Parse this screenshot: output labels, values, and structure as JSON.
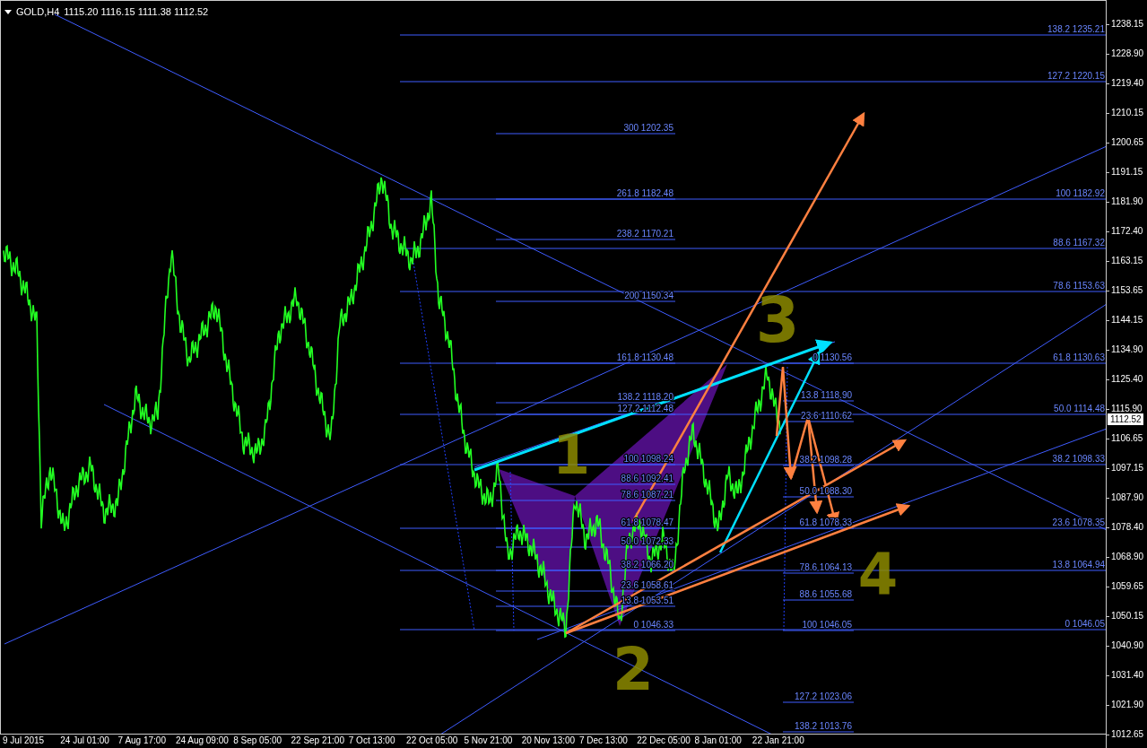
{
  "header": {
    "symbol": "GOLD,H4",
    "quotes": "1115.20 1116.15 1111.38 1112.52"
  },
  "fib_sets": [
    {
      "labels": [
        "300 1202.35",
        "261.8 1182.48",
        "238.2 1170.21",
        "200 1150.34",
        "161.8 1130.48",
        "138.2 1118.20",
        "127.2 1112.48",
        "100 1098.24",
        "88.6 1092.41",
        "78.6 1087.21",
        "61.8 1078.47",
        "50.0 1072.33",
        "38.2 1066.20",
        "23.6 1058.61",
        "13.8 1053.51",
        "0 1046.33"
      ]
    },
    {
      "labels": [
        "0 1130.56",
        "13.8 1118.90",
        "23.6 1110.62",
        "38.2 1098.28",
        "50.0 1088.30",
        "61.8 1078.33",
        "78.6 1064.13",
        "88.6 1055.68",
        "100 1046.05",
        "127.2 1023.06",
        "138.2 1013.76"
      ]
    },
    {
      "labels": [
        "138.2 1235.21",
        "127.2 1220.15",
        "100 1182.92",
        "88.6 1167.32",
        "78.6 1153.63",
        "61.8 1130.63",
        "50.0 1114.48",
        "38.2 1098.33",
        "23.6 1078.35",
        "13.8 1064.94",
        "0 1046.05"
      ]
    }
  ],
  "annotations": [
    {
      "text": "1"
    },
    {
      "text": "2"
    },
    {
      "text": "3"
    },
    {
      "text": "4"
    }
  ],
  "price_axis": [
    "1238.15",
    "1228.90",
    "1219.40",
    "1210.15",
    "1200.65",
    "1191.15",
    "1181.90",
    "1172.40",
    "1163.15",
    "1153.65",
    "1144.15",
    "1134.90",
    "1125.40",
    "1115.90",
    "1106.65",
    "1097.15",
    "1087.90",
    "1078.40",
    "1068.90",
    "1059.65",
    "1050.15",
    "1040.90",
    "1031.40",
    "1021.90",
    "1012.65"
  ],
  "current_price": "1112.52",
  "time_axis": [
    "9 Jul 2015",
    "24 Jul 01:00",
    "7 Aug 17:00",
    "24 Aug 09:00",
    "8 Sep 05:00",
    "22 Sep 21:00",
    "7 Oct 13:00",
    "22 Oct 05:00",
    "5 Nov 21:00",
    "20 Nov 13:00",
    "7 Dec 13:00",
    "22 Dec 05:00",
    "8 Jan 01:00",
    "22 Jan 21:00"
  ]
}
